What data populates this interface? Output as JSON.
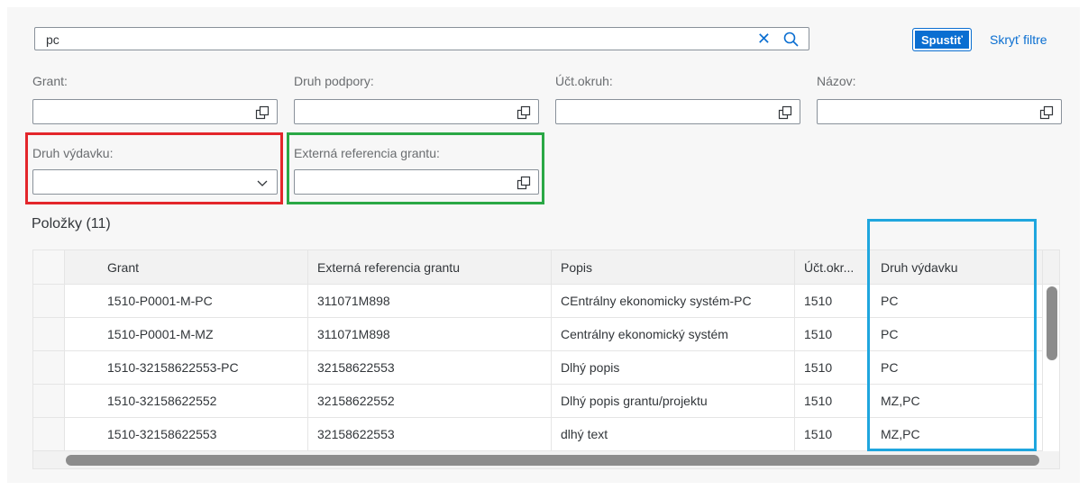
{
  "search": {
    "value": "pc"
  },
  "toolbar": {
    "go_label": "Spustiť",
    "hide_filters_label": "Skryť filtre"
  },
  "filters": {
    "grant": {
      "label": "Grant:"
    },
    "support_type": {
      "label": "Druh podpory:"
    },
    "account_area": {
      "label": "Účt.okruh:"
    },
    "name": {
      "label": "Názov:"
    },
    "expense_type": {
      "label": "Druh výdavku:"
    },
    "external_ref": {
      "label": "Externá referencia grantu:"
    }
  },
  "items": {
    "title": "Položky (11)"
  },
  "table": {
    "columns": [
      "Grant",
      "Externá referencia grantu",
      "Popis",
      "Účt.okr...",
      "Druh výdavku"
    ],
    "rows": [
      [
        "1510-P0001-M-PC",
        "311071M898",
        "CEntrálny ekonomicky systém-PC",
        "1510",
        "PC"
      ],
      [
        "1510-P0001-M-MZ",
        "311071M898",
        "Centrálny ekonomický systém",
        "1510",
        "PC"
      ],
      [
        "1510-32158622553-PC",
        "32158622553",
        "Dlhý popis",
        "1510",
        "PC"
      ],
      [
        "1510-32158622552",
        "32158622552",
        "Dlhý popis grantu/projektu",
        "1510",
        "MZ,PC"
      ],
      [
        "1510-32158622553",
        "32158622553",
        "dlhý text",
        "1510",
        "MZ,PC"
      ]
    ]
  },
  "colors": {
    "accent": "#0a6ed1",
    "highlight_red": "#e3262b",
    "highlight_green": "#2aa845",
    "highlight_blue": "#1fa6de"
  },
  "icons": {
    "clear": "close-icon",
    "search": "search-icon",
    "value_help": "value-help-icon",
    "dropdown": "chevron-down-icon"
  }
}
